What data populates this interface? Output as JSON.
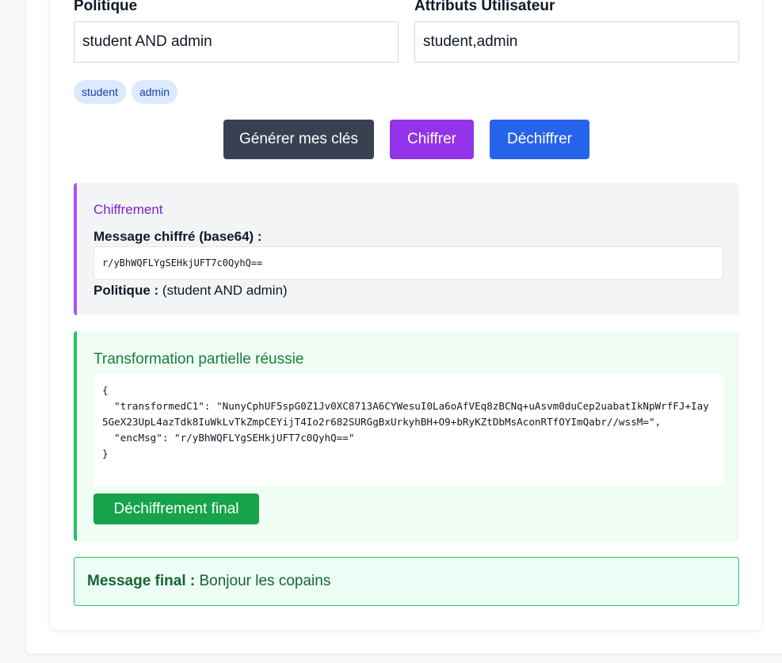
{
  "form": {
    "policy_label": "Politique",
    "policy_value": "student AND admin",
    "attributes_label": "Attributs Utilisateur",
    "attributes_value": "student,admin",
    "tags": [
      "student",
      "admin"
    ]
  },
  "buttons": {
    "generate": "Générer mes clés",
    "encrypt": "Chiffrer",
    "decrypt": "Déchiffrer"
  },
  "encryption": {
    "title": "Chiffrement",
    "cipher_label": "Message chiffré (base64) :",
    "cipher_value": "r/yBhWQFLYgSEHkjUFT7c0QyhQ==",
    "policy_label": "Politique :",
    "policy_value": "(student AND admin)"
  },
  "transformation": {
    "title": "Transformation partielle réussie",
    "json": "{\n  \"transformedC1\": \"NunyCphUF5spG0Z1Jv0XC8713A6CYWesuI0La6oAfVEq8zBCNq+uAsvm0duCep2uabatIkNpWrfFJ+Iay5GeX23UpL4azTdk8IuWkLvTkZmpCEYijT4Io2r682SURGgBxUrkyhBH+O9+bRyKZtDbMsAconRTfOYImQabr//wssM=\",\n  \"encMsg\": \"r/yBhWQFLYgSEHkjUFT7c0QyhQ==\"\n}",
    "final_button": "Déchiffrement final"
  },
  "final": {
    "label": "Message final :",
    "value": "Bonjour les copains"
  },
  "colors": {
    "generate_button": "#374151",
    "encrypt_button": "#9333ea",
    "decrypt_button": "#2563eb",
    "final_button": "#16a34a",
    "encryption_accent": "#a855f7",
    "transformation_accent": "#22c55e"
  }
}
